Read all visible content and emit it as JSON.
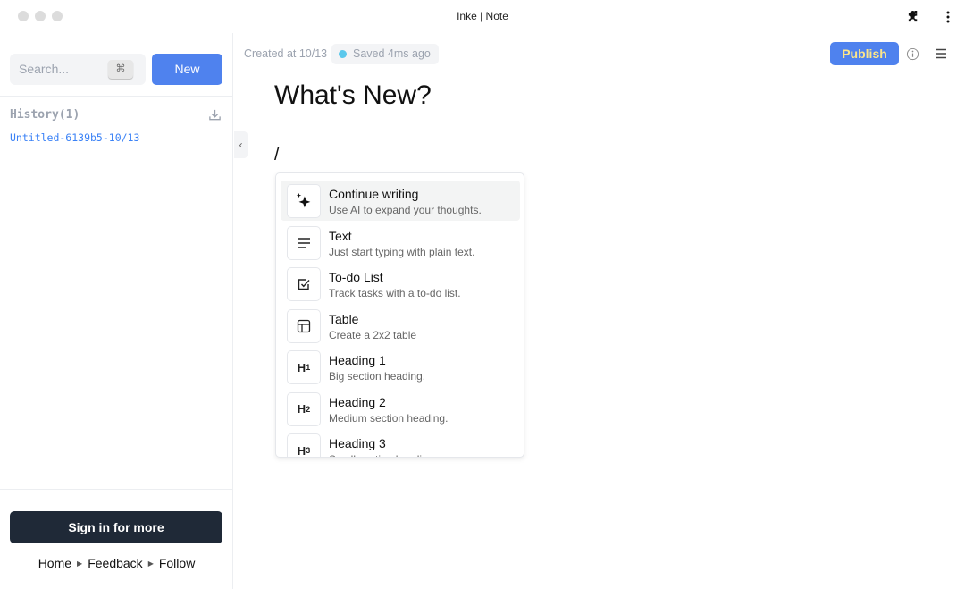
{
  "window": {
    "title": "Inke | Note"
  },
  "sidebar": {
    "search_placeholder": "Search...",
    "shortcut": "⌘",
    "new_label": "New",
    "history_label": "History(1)",
    "history_items": [
      "Untitled-6139b5-10/13"
    ],
    "signin_label": "Sign in for more",
    "links": [
      "Home",
      "Feedback",
      "Follow"
    ]
  },
  "editor": {
    "created": "Created at 10/13",
    "saved": "Saved 4ms ago",
    "saved_color": "#5bc8ec",
    "publish_label": "Publish",
    "title": "What's New?",
    "slash": "/",
    "menu": [
      {
        "title": "Continue writing",
        "desc": "Use AI to expand your thoughts.",
        "icon": "sparkles"
      },
      {
        "title": "Text",
        "desc": "Just start typing with plain text.",
        "icon": "text-lines"
      },
      {
        "title": "To-do List",
        "desc": "Track tasks with a to-do list.",
        "icon": "checkbox"
      },
      {
        "title": "Table",
        "desc": "Create a 2x2 table",
        "icon": "table"
      },
      {
        "title": "Heading 1",
        "desc": "Big section heading.",
        "icon": "H1"
      },
      {
        "title": "Heading 2",
        "desc": "Medium section heading.",
        "icon": "H2"
      },
      {
        "title": "Heading 3",
        "desc": "Small section heading.",
        "icon": "H3"
      }
    ]
  },
  "colors": {
    "accent": "#4f82ee",
    "dark_button": "#1f2937",
    "link": "#3b82f6"
  }
}
